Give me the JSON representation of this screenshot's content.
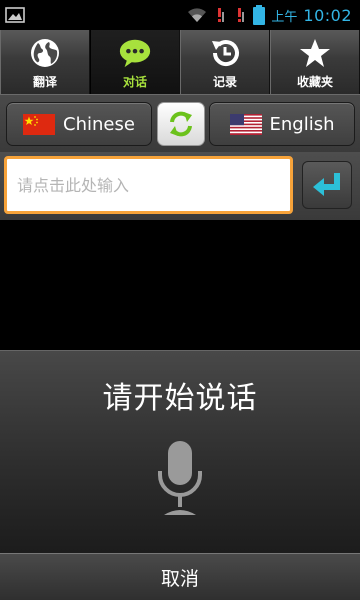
{
  "status_bar": {
    "ampm": "上午",
    "time": "10:02",
    "accent": "#33b5e5"
  },
  "tabs": [
    {
      "label": "翻译",
      "icon": "globe-icon",
      "active": false
    },
    {
      "label": "对话",
      "icon": "chat-bubble-icon",
      "active": true
    },
    {
      "label": "记录",
      "icon": "history-icon",
      "active": false
    },
    {
      "label": "收藏夹",
      "icon": "star-icon",
      "active": false
    }
  ],
  "language_bar": {
    "source_language": "Chinese",
    "source_flag": "china-flag-icon",
    "swap_icon": "swap-icon",
    "target_language": "English",
    "target_flag": "us-flag-icon"
  },
  "input": {
    "placeholder": "请点击此处输入",
    "value": "",
    "focus_color": "#f7a33a",
    "submit_icon": "enter-arrow-icon"
  },
  "speech_dialog": {
    "prompt": "请开始说话",
    "icon": "microphone-icon",
    "cancel_label": "取消"
  }
}
